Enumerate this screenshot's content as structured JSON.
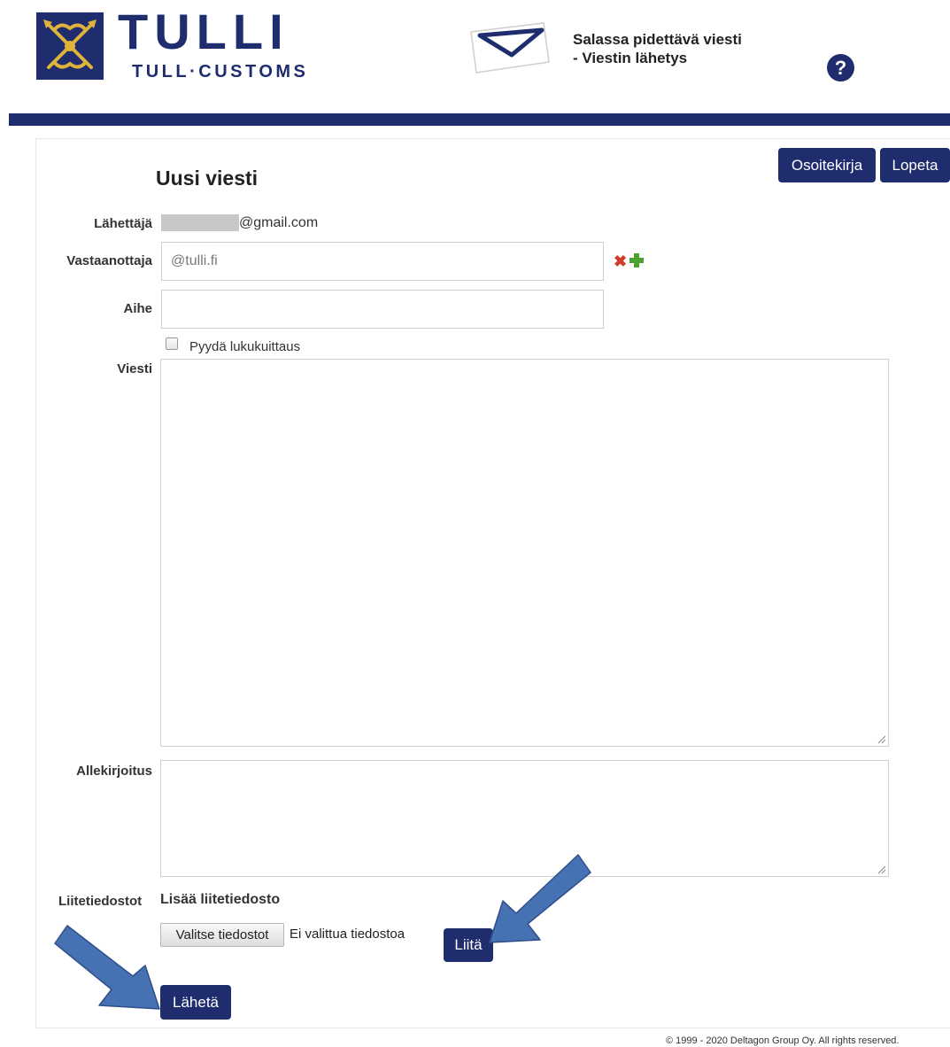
{
  "header": {
    "brand_title": "TULLI",
    "brand_subtitle": "TULL·CUSTOMS",
    "service_line1": "Salassa pidettävä viesti",
    "service_line2": "- Viestin lähetys",
    "help_symbol": "?"
  },
  "nav": {
    "address_book_label": "Osoitekirja",
    "logout_label": "Lopeta"
  },
  "form": {
    "title": "Uusi viesti",
    "sender_label": "Lähettäjä",
    "sender_value": "@gmail.com",
    "recipient_label": "Vastaanottaja",
    "recipient_value": "@tulli.fi",
    "subject_label": "Aihe",
    "subject_value": "",
    "read_receipt_label": "Pyydä lukukuittaus",
    "read_receipt_checked": false,
    "message_label": "Viesti",
    "message_value": "",
    "signature_label": "Allekirjoitus",
    "signature_value": "",
    "attachments_label": "Liitetiedostot",
    "add_attachment_title": "Lisää liitetiedosto",
    "choose_files_label": "Valitse tiedostot",
    "no_file_text": "Ei valittua tiedostoa",
    "attach_button_label": "Liitä",
    "send_button_label": "Lähetä"
  },
  "icons": {
    "remove_recipient": "remove-icon",
    "add_recipient": "add-icon",
    "help": "help-icon",
    "envelope": "envelope-icon",
    "emblem": "customs-emblem-icon"
  },
  "colors": {
    "brand_navy": "#1f2d6e",
    "emblem_gold": "#e0b43a",
    "remove_red": "#d23a2a",
    "add_green": "#4aa331",
    "annotation_arrow": "#4672b4"
  },
  "footer": {
    "copyright": "© 1999 - 2020 Deltagon Group Oy. All rights reserved."
  }
}
